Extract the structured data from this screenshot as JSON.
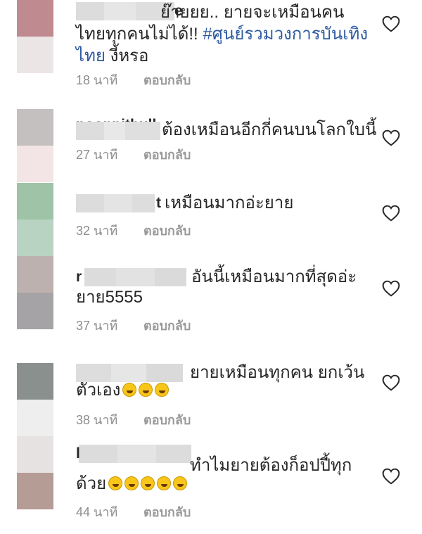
{
  "comments": [
    {
      "username_tail": "e",
      "line1": "ย๊ายยย.. ยายจะเหมือนคน",
      "line2_text": "ไทยทุกคนไม่ได้!! ",
      "line2_hashtag": "#ศูนย์รวมวงการบันเทิง",
      "line3_hashtag": "ไทย",
      "line3_text": " งี้หรอ",
      "time": "18 นาที",
      "reply": "ตอบกลับ"
    },
    {
      "username_tail": "noonpithull",
      "line1": "ต้องเหมือนอีกกี่คนบนโลกใบนี้",
      "time": "27 นาที",
      "reply": "ตอบกลับ"
    },
    {
      "username_tail": "t",
      "line1": "เหมือนมากอ่ะยาย",
      "time": "32 นาที",
      "reply": "ตอบกลับ"
    },
    {
      "username_tail": "r",
      "line1": "อันนี้เหมือนมากที่สุดอ่ะ",
      "line2": "ยาย5555",
      "time": "37 นาที",
      "reply": "ตอบกลับ"
    },
    {
      "line1": "ยายเหมือนทุกคน ยกเว้น",
      "line2": "ตัวเอง",
      "emoji_name": "rolling-on-floor-laughing",
      "time": "38 นาที",
      "reply": "ตอบกลับ"
    },
    {
      "username_tail": "l",
      "line1": "ทำไมยายต้องก็อปปี้ทุก",
      "line2": "ด้วย",
      "emoji_name": "rolling-on-floor-laughing",
      "time": "44 นาที",
      "reply": "ตอบกลับ"
    }
  ],
  "icons": {
    "like": "heart-outline-icon",
    "emoji": "rolling-on-floor-laughing-emoji"
  },
  "colors": {
    "text": "#262626",
    "meta": "#8e8e8e",
    "hashtag": "#2c5aa0"
  }
}
